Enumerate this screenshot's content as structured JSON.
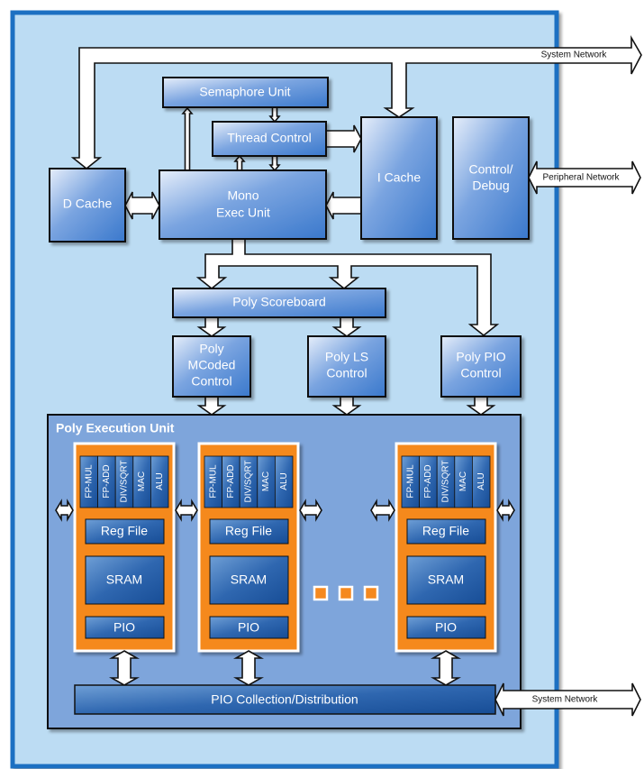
{
  "colors": {
    "frame_border": "#1b6fc2",
    "frame_fill": "#bcdcf3",
    "block_light": "#e6eefa",
    "block_dark": "#3a78cc",
    "poly_unit_fill": "#7ea5db",
    "pe_orange": "#f5891f",
    "pe_dark_blue": "#1d5aa5"
  },
  "networks": {
    "system_top": "System Network",
    "peripheral": "Peripheral Network",
    "system_bottom": "System Network"
  },
  "blocks": {
    "semaphore": "Semaphore Unit",
    "thread_control": "Thread Control",
    "d_cache": "D Cache",
    "mono_exec": [
      "Mono",
      "Exec Unit"
    ],
    "i_cache": "I Cache",
    "control_debug": [
      "Control/",
      "Debug"
    ],
    "poly_scoreboard": "Poly Scoreboard",
    "poly_mcoded": [
      "Poly",
      "MCoded",
      "Control"
    ],
    "poly_ls": [
      "Poly LS",
      "Control"
    ],
    "poly_pio": [
      "Poly PIO",
      "Control"
    ]
  },
  "poly_unit": {
    "title": "Poly Execution Unit",
    "functional_units": [
      "FP-MUL",
      "FP-ADD",
      "DIV/SQRT",
      "MAC",
      "ALU"
    ],
    "reg_file": "Reg File",
    "sram": "SRAM",
    "pio": "PIO",
    "collection": "PIO Collection/Distribution"
  }
}
